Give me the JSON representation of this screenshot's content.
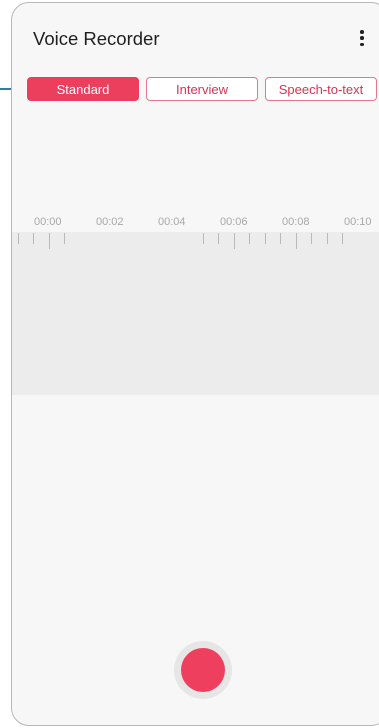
{
  "app": {
    "title": "Voice Recorder",
    "menu_icon": "more-vert-icon"
  },
  "modes": {
    "items": [
      {
        "label": "Standard",
        "active": true
      },
      {
        "label": "Interview",
        "active": false
      },
      {
        "label": "Speech-to-text",
        "active": false
      }
    ]
  },
  "timeline": {
    "labels": [
      "00:00",
      "00:02",
      "00:04",
      "00:06",
      "00:08",
      "00:10"
    ]
  },
  "record": {
    "icon": "record-icon"
  },
  "colors": {
    "accent": "#ec3f5e",
    "callout": "#2e7ea6"
  }
}
